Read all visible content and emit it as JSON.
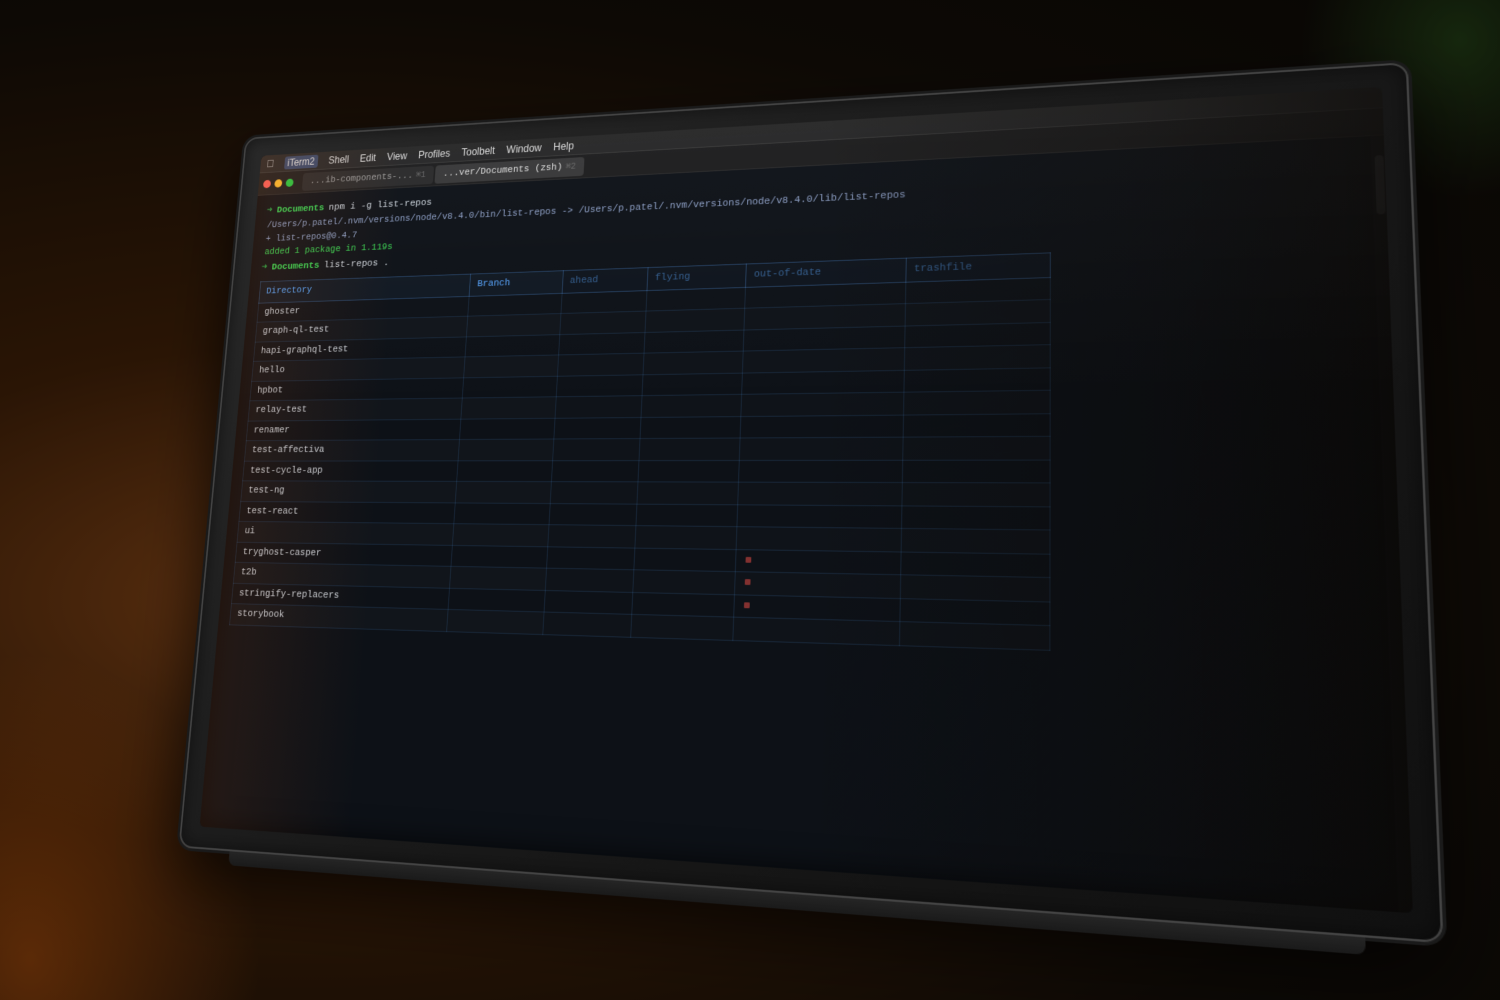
{
  "background": {
    "color": "#1a0e08"
  },
  "menubar": {
    "apple": "",
    "app_name": "iTerm2",
    "menus": [
      "Shell",
      "Edit",
      "View",
      "Profiles",
      "Toolbelt",
      "Window",
      "Help"
    ]
  },
  "tabs": [
    {
      "label": "...ib-components-...",
      "num": "⌘1",
      "active": false
    },
    {
      "label": "...ver/Documents (zsh)",
      "num": "⌘2",
      "active": true
    }
  ],
  "terminal": {
    "prompt_dir": "Documents",
    "command": "npm i -g list-repos",
    "output_lines": [
      "/Users/p.patel/.nvm/versions/node/v8.4.0/bin/list-repos -> /Users/p.patel/.nvm/versions/node/v8.4.0/lib/list-repos",
      "+ list-repos@0.4.7",
      "added 1 package in 1.119s"
    ],
    "prompt2_dir": "Documents",
    "command2": "list-repos ."
  },
  "table": {
    "headers": [
      "Directory",
      "Branch",
      "ahead",
      "flying",
      "out-of-date",
      "trashfile"
    ],
    "rows": [
      {
        "dir": "ghoster",
        "branch": "",
        "ahead": "",
        "flying": "",
        "out": "",
        "trash": ""
      },
      {
        "dir": "graph-ql-test",
        "branch": "",
        "ahead": "",
        "flying": "",
        "out": "",
        "trash": ""
      },
      {
        "dir": "hapi-graphql-test",
        "branch": "",
        "ahead": "",
        "flying": "",
        "out": "",
        "trash": ""
      },
      {
        "dir": "hello",
        "branch": "",
        "ahead": "",
        "flying": "",
        "out": "",
        "trash": ""
      },
      {
        "dir": "hpbot",
        "branch": "",
        "ahead": "",
        "flying": "",
        "out": "",
        "trash": ""
      },
      {
        "dir": "relay-test",
        "branch": "",
        "ahead": "",
        "flying": "",
        "out": "",
        "trash": ""
      },
      {
        "dir": "renamer",
        "branch": "",
        "ahead": "",
        "flying": "",
        "out": "",
        "trash": ""
      },
      {
        "dir": "test-affectiva",
        "branch": "",
        "ahead": "",
        "flying": "",
        "out": "",
        "trash": ""
      },
      {
        "dir": "test-cycle-app",
        "branch": "",
        "ahead": "",
        "flying": "",
        "out": "",
        "trash": ""
      },
      {
        "dir": "test-ng",
        "branch": "",
        "ahead": "",
        "flying": "",
        "out": "",
        "trash": ""
      },
      {
        "dir": "test-react",
        "branch": "",
        "ahead": "",
        "flying": "",
        "out": "",
        "trash": ""
      },
      {
        "dir": "ui",
        "branch": "",
        "ahead": "",
        "flying": "",
        "out": "",
        "trash": ""
      },
      {
        "dir": "tryghost-casper",
        "branch": "",
        "ahead": "",
        "flying": "",
        "out": "",
        "trash": ""
      },
      {
        "dir": "t2b",
        "branch": "",
        "ahead": "",
        "flying": "",
        "out": "",
        "trash": ""
      },
      {
        "dir": "stringify-replacers",
        "branch": "",
        "ahead": "",
        "flying": "",
        "out": "",
        "trash": ""
      },
      {
        "dir": "storybook",
        "branch": "",
        "ahead": "",
        "flying": "",
        "out": "",
        "trash": ""
      }
    ]
  }
}
